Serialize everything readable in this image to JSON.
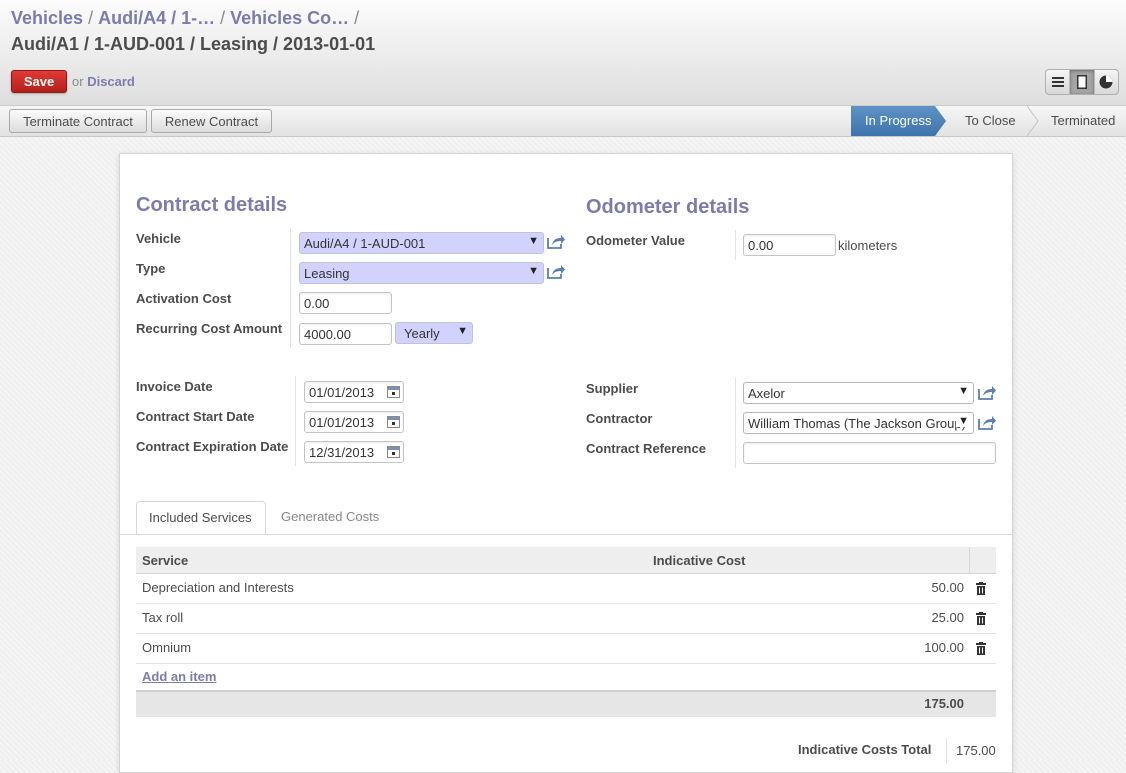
{
  "breadcrumb": {
    "items": [
      "Vehicles",
      "Audi/A4 / 1-…",
      "Vehicles Co…"
    ],
    "separator": "/"
  },
  "page_title": "Audi/A1 / 1-AUD-001 / Leasing / 2013-01-01",
  "actions": {
    "save": "Save",
    "or": "or",
    "discard": "Discard"
  },
  "view_switcher": [
    "list-view-icon",
    "form-view-icon",
    "graph-view-icon"
  ],
  "statusbar": {
    "buttons": [
      "Terminate Contract",
      "Renew Contract"
    ],
    "stages": [
      {
        "label": "In Progress",
        "active": true
      },
      {
        "label": "To Close",
        "active": false
      },
      {
        "label": "Terminated",
        "active": false
      }
    ]
  },
  "contract_details": {
    "title": "Contract details",
    "vehicle_label": "Vehicle",
    "vehicle_value": "Audi/A4 / 1-AUD-001",
    "type_label": "Type",
    "type_value": "Leasing",
    "activation_cost_label": "Activation Cost",
    "activation_cost_value": "0.00",
    "recurring_cost_label": "Recurring Cost Amount",
    "recurring_cost_value": "4000.00",
    "recurring_frequency": "Yearly"
  },
  "odometer_details": {
    "title": "Odometer details",
    "value_label": "Odometer Value",
    "value": "0.00",
    "unit": "kilometers"
  },
  "dates": {
    "invoice_label": "Invoice Date",
    "invoice_value": "01/01/2013",
    "start_label": "Contract Start Date",
    "start_value": "01/01/2013",
    "expiration_label": "Contract Expiration Date",
    "expiration_value": "12/31/2013"
  },
  "parties": {
    "supplier_label": "Supplier",
    "supplier_value": "Axelor",
    "contractor_label": "Contractor",
    "contractor_value": "William Thomas (The Jackson Group)",
    "reference_label": "Contract Reference",
    "reference_value": ""
  },
  "tabs": [
    "Included Services",
    "Generated Costs"
  ],
  "services_table": {
    "headers": [
      "Service",
      "Indicative Cost"
    ],
    "rows": [
      {
        "service": "Depreciation and Interests",
        "cost": "50.00"
      },
      {
        "service": "Tax roll",
        "cost": "25.00"
      },
      {
        "service": "Omnium",
        "cost": "100.00"
      }
    ],
    "add_item": "Add an item",
    "footer_total": "175.00"
  },
  "indicative_costs_total": {
    "label": "Indicative Costs Total",
    "value": "175.00"
  },
  "colors": {
    "accent": "#7c7bad",
    "save_red": "#c9241f",
    "status_active": "#4a80b9",
    "many2one_bg": "#d2d2ff"
  }
}
